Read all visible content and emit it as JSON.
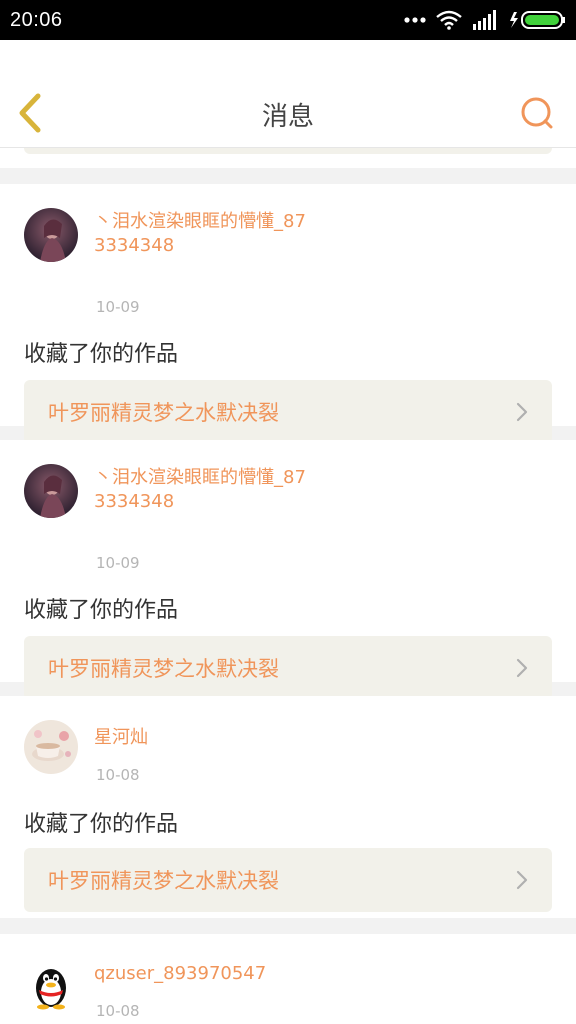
{
  "status_bar": {
    "time": "20:06"
  },
  "header": {
    "title": "消息"
  },
  "icons": {
    "back": "back-chevron-icon",
    "search": "search-icon",
    "item_arrow": "chevron-right-icon"
  },
  "colors": {
    "accent": "#f0955a",
    "card_bg": "#ffffff",
    "link_bg": "#f2f1ea",
    "divider": "#f2f2f2"
  },
  "messages": [
    {
      "username": "丶泪水渲染眼眶的懵懂_873334348",
      "date": "10-09",
      "action": "收藏了你的作品",
      "work_title": "叶罗丽精灵梦之水默决裂"
    },
    {
      "username": "丶泪水渲染眼眶的懵懂_873334348",
      "date": "10-09",
      "action": "收藏了你的作品",
      "work_title": "叶罗丽精灵梦之水默决裂"
    },
    {
      "username": "星河灿",
      "date": "10-08",
      "action": "收藏了你的作品",
      "work_title": "叶罗丽精灵梦之水默决裂"
    },
    {
      "username": "qzuser_893970547",
      "date": "10-08"
    }
  ]
}
